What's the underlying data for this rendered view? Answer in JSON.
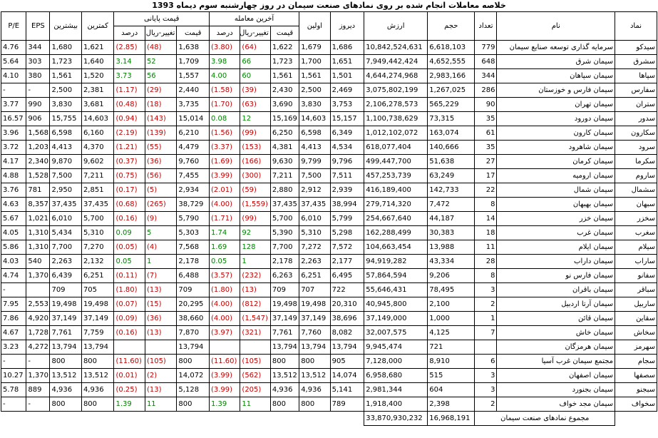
{
  "title": "خلاصه معاملات انجام شده بر روی نمادهای صنعت سیمان در روز چهارشنبه سوم دیماه 1393",
  "headers": {
    "symbol": "نماد",
    "name": "نام",
    "count": "تعداد",
    "volume": "حجم",
    "value": "ارزش",
    "yesterday": "دیروز",
    "first": "اولین",
    "last_trade": "آخرین معامله",
    "final_price": "قیمت پایانی",
    "price": "قیمت",
    "change": "تغییر-ریال",
    "percent": "درصد",
    "min": "کمترین",
    "max": "بیشترین",
    "eps": "EPS",
    "pe": "P/E"
  },
  "rows": [
    {
      "sym": "سیدکو",
      "name": "سرمایه گذاری توسعه صنایع سیمان",
      "count": "779",
      "vol": "6,618,103",
      "val": "10,842,524,631",
      "yest": "1,686",
      "first": "1,679",
      "lp": "1,622",
      "lc": "(64)",
      "lpct": "(3.80)",
      "fp": "1,638",
      "fc": "(48)",
      "fpct": "(2.85)",
      "min": "1,621",
      "max": "1,680",
      "eps": "344",
      "pe": "4.76"
    },
    {
      "sym": "سشرق",
      "name": "سیمان شرق",
      "count": "648",
      "vol": "4,652,555",
      "val": "7,949,442,424",
      "yest": "1,651",
      "first": "1,700",
      "lp": "1,723",
      "lc": "66",
      "lpct": "3.98",
      "fp": "1,709",
      "fc": "52",
      "fpct": "3.14",
      "min": "1,640",
      "max": "1,723",
      "eps": "303",
      "pe": "5.64"
    },
    {
      "sym": "سپاها",
      "name": "سیمان سپاهان",
      "count": "344",
      "vol": "2,983,166",
      "val": "4,644,274,968",
      "yest": "1,501",
      "first": "1,561",
      "lp": "1,561",
      "lc": "60",
      "lpct": "4.00",
      "fp": "1,557",
      "fc": "56",
      "fpct": "3.73",
      "min": "1,520",
      "max": "1,561",
      "eps": "380",
      "pe": "4.10"
    },
    {
      "sym": "سفارس",
      "name": "سیمان فارس و خوزستان",
      "count": "286",
      "vol": "1,267,025",
      "val": "3,075,802,199",
      "yest": "2,469",
      "first": "2,500",
      "lp": "2,430",
      "lc": "(39)",
      "lpct": "(1.58)",
      "fp": "2,440",
      "fc": "(29)",
      "fpct": "(1.17)",
      "min": "2,381",
      "max": "2,500",
      "eps": "-",
      "pe": "-"
    },
    {
      "sym": "ستران",
      "name": "سیمان تهران",
      "count": "90",
      "vol": "565,229",
      "val": "2,106,278,573",
      "yest": "3,753",
      "first": "3,830",
      "lp": "3,690",
      "lc": "(63)",
      "lpct": "(1.70)",
      "fp": "3,735",
      "fc": "(18)",
      "fpct": "(0.48)",
      "min": "3,681",
      "max": "3,830",
      "eps": "990",
      "pe": "3.77"
    },
    {
      "sym": "سدور",
      "name": "سیمان دورود",
      "count": "35",
      "vol": "73,315",
      "val": "1,100,738,629",
      "yest": "15,157",
      "first": "14,603",
      "lp": "15,169",
      "lc": "12",
      "lpct": "0.08",
      "fp": "15,014",
      "fc": "(143)",
      "fpct": "(0.94)",
      "min": "14,603",
      "max": "15,755",
      "eps": "906",
      "pe": "16.57"
    },
    {
      "sym": "سکارون",
      "name": "سیمان کارون",
      "count": "61",
      "vol": "163,074",
      "val": "1,012,102,072",
      "yest": "6,349",
      "first": "6,598",
      "lp": "6,250",
      "lc": "(99)",
      "lpct": "(1.56)",
      "fp": "6,210",
      "fc": "(139)",
      "fpct": "(2.19)",
      "min": "6,160",
      "max": "6,598",
      "eps": "1,568",
      "pe": "3.96"
    },
    {
      "sym": "سرود",
      "name": "سیمان شاهرود",
      "count": "35",
      "vol": "140,666",
      "val": "618,077,404",
      "yest": "4,534",
      "first": "4,413",
      "lp": "4,381",
      "lc": "(153)",
      "lpct": "(3.37)",
      "fp": "4,479",
      "fc": "(55)",
      "fpct": "(1.21)",
      "min": "4,370",
      "max": "4,413",
      "eps": "1,203",
      "pe": "3.72"
    },
    {
      "sym": "سکرما",
      "name": "سیمان کرمان",
      "count": "27",
      "vol": "51,638",
      "val": "499,447,700",
      "yest": "9,796",
      "first": "9,799",
      "lp": "9,630",
      "lc": "(166)",
      "lpct": "(1.69)",
      "fp": "9,760",
      "fc": "(36)",
      "fpct": "(0.37)",
      "min": "9,602",
      "max": "9,870",
      "eps": "2,340",
      "pe": "4.17"
    },
    {
      "sym": "ساروم",
      "name": "سیمان ارومیه",
      "count": "17",
      "vol": "63,249",
      "val": "457,253,739",
      "yest": "7,511",
      "first": "7,500",
      "lp": "7,211",
      "lc": "(300)",
      "lpct": "(3.99)",
      "fp": "7,455",
      "fc": "(56)",
      "fpct": "(0.75)",
      "min": "7,211",
      "max": "7,500",
      "eps": "1,528",
      "pe": "4.88"
    },
    {
      "sym": "سشمال",
      "name": "سیمان شمال",
      "count": "22",
      "vol": "142,733",
      "val": "416,189,400",
      "yest": "2,939",
      "first": "2,912",
      "lp": "2,880",
      "lc": "(59)",
      "lpct": "(2.01)",
      "fp": "2,934",
      "fc": "(5)",
      "fpct": "(0.17)",
      "min": "2,851",
      "max": "2,950",
      "eps": "781",
      "pe": "3.76"
    },
    {
      "sym": "سبهان",
      "name": "سیمان بهبهان",
      "count": "8",
      "vol": "7,472",
      "val": "279,714,320",
      "yest": "38,994",
      "first": "37,435",
      "lp": "37,435",
      "lc": "(1,559)",
      "lpct": "(4.00)",
      "fp": "38,729",
      "fc": "(265)",
      "fpct": "(0.68)",
      "min": "37,435",
      "max": "37,435",
      "eps": "8,357",
      "pe": "4.63"
    },
    {
      "sym": "سخزر",
      "name": "سیمان خزر",
      "count": "14",
      "vol": "44,187",
      "val": "254,667,640",
      "yest": "5,799",
      "first": "6,010",
      "lp": "5,700",
      "lc": "(99)",
      "lpct": "(1.71)",
      "fp": "5,790",
      "fc": "(9)",
      "fpct": "(0.16)",
      "min": "5,700",
      "max": "6,010",
      "eps": "1,021",
      "pe": "5.67"
    },
    {
      "sym": "سغرب",
      "name": "سیمان غرب",
      "count": "18",
      "vol": "30,383",
      "val": "162,288,499",
      "yest": "5,298",
      "first": "5,310",
      "lp": "5,390",
      "lc": "92",
      "lpct": "1.74",
      "fp": "5,303",
      "fc": "5",
      "fpct": "0.09",
      "min": "5,310",
      "max": "5,434",
      "eps": "1,310",
      "pe": "4.05"
    },
    {
      "sym": "سیلام",
      "name": "سیمان ایلام",
      "count": "11",
      "vol": "13,988",
      "val": "104,663,454",
      "yest": "7,572",
      "first": "7,272",
      "lp": "7,700",
      "lc": "128",
      "lpct": "1.69",
      "fp": "7,568",
      "fc": "(4)",
      "fpct": "(0.05)",
      "min": "7,270",
      "max": "7,700",
      "eps": "1,310",
      "pe": "5.86"
    },
    {
      "sym": "ساراب",
      "name": "سیمان داراب",
      "count": "28",
      "vol": "43,334",
      "val": "94,919,282",
      "yest": "2,177",
      "first": "2,263",
      "lp": "2,178",
      "lc": "1",
      "lpct": "0.05",
      "fp": "2,178",
      "fc": "1",
      "fpct": "0.05",
      "min": "2,132",
      "max": "2,263",
      "eps": "540",
      "pe": "4.03"
    },
    {
      "sym": "سفانو",
      "name": "سیمان فارس نو",
      "count": "8",
      "vol": "9,206",
      "val": "57,864,594",
      "yest": "6,495",
      "first": "6,251",
      "lp": "6,263",
      "lc": "(232)",
      "lpct": "(3.57)",
      "fp": "6,488",
      "fc": "(7)",
      "fpct": "(0.11)",
      "min": "6,251",
      "max": "6,439",
      "eps": "1,370",
      "pe": "4.74"
    },
    {
      "sym": "سباقر",
      "name": "سیمان باقران",
      "count": "3",
      "vol": "78,495",
      "val": "55,646,431",
      "yest": "722",
      "first": "707",
      "lp": "709",
      "lc": "(13)",
      "lpct": "(1.80)",
      "fp": "709",
      "fc": "(13)",
      "fpct": "(1.80)",
      "min": "705",
      "max": "709",
      "eps": "",
      "pe": "-"
    },
    {
      "sym": "ساربیل",
      "name": "سیمان آرتا اردبیل",
      "count": "2",
      "vol": "2,100",
      "val": "40,945,800",
      "yest": "20,310",
      "first": "19,498",
      "lp": "19,498",
      "lc": "(812)",
      "lpct": "(4.00)",
      "fp": "20,295",
      "fc": "(15)",
      "fpct": "(0.07)",
      "min": "19,498",
      "max": "19,498",
      "eps": "2,553",
      "pe": "7.95"
    },
    {
      "sym": "سقاین",
      "name": "سیمان قائن",
      "count": "1",
      "vol": "1,000",
      "val": "37,149,000",
      "yest": "38,696",
      "first": "37,149",
      "lp": "37,149",
      "lc": "(1,547)",
      "lpct": "(4.00)",
      "fp": "38,660",
      "fc": "(36)",
      "fpct": "(0.09)",
      "min": "37,149",
      "max": "37,149",
      "eps": "4,920",
      "pe": "7.86"
    },
    {
      "sym": "سخاش",
      "name": "سیمان خاش",
      "count": "7",
      "vol": "4,125",
      "val": "32,007,575",
      "yest": "8,082",
      "first": "7,760",
      "lp": "7,761",
      "lc": "(321)",
      "lpct": "(3.97)",
      "fp": "7,870",
      "fc": "(13)",
      "fpct": "(0.16)",
      "min": "7,759",
      "max": "7,761",
      "eps": "1,728",
      "pe": "4.67"
    },
    {
      "sym": "سهرمز",
      "name": "سیمان هرمزگان",
      "count": "",
      "vol": "721",
      "val": "9,945,474",
      "yest": "13,794",
      "first": "13,794",
      "lp": "13,794",
      "lc": "",
      "lpct": "",
      "fp": "13,794",
      "fc": "",
      "fpct": "",
      "min": "13,794",
      "max": "13,794",
      "eps": "4,272",
      "pe": "3.23"
    },
    {
      "sym": "سجام",
      "name": "مجتمع سیمان غرب آسیا",
      "count": "6",
      "vol": "8,910",
      "val": "7,128,000",
      "yest": "905",
      "first": "800",
      "lp": "800",
      "lc": "(105)",
      "lpct": "(11.60)",
      "fp": "800",
      "fc": "(105)",
      "fpct": "(11.60)",
      "min": "800",
      "max": "800",
      "eps": "-",
      "pe": "-"
    },
    {
      "sym": "سصفها",
      "name": "سیمان اصفهان",
      "count": "3",
      "vol": "515",
      "val": "6,958,680",
      "yest": "14,074",
      "first": "13,512",
      "lp": "13,512",
      "lc": "(562)",
      "lpct": "(3.99)",
      "fp": "14,072",
      "fc": "(2)",
      "fpct": "(0.01)",
      "min": "13,512",
      "max": "13,512",
      "eps": "1,370",
      "pe": "10.27"
    },
    {
      "sym": "سبجنو",
      "name": "سیمان بجنورد",
      "count": "3",
      "vol": "604",
      "val": "2,981,344",
      "yest": "5,141",
      "first": "4,936",
      "lp": "4,936",
      "lc": "(205)",
      "lpct": "(3.99)",
      "fp": "5,128",
      "fc": "(13)",
      "fpct": "(0.25)",
      "min": "4,936",
      "max": "4,936",
      "eps": "889",
      "pe": "5.78"
    },
    {
      "sym": "سخواف",
      "name": "سیمان مجد خواف",
      "count": "2",
      "vol": "2,398",
      "val": "1,918,400",
      "yest": "789",
      "first": "800",
      "lp": "800",
      "lc": "11",
      "lpct": "1.39",
      "fp": "800",
      "fc": "11",
      "fpct": "1.39",
      "min": "800",
      "max": "800",
      "eps": "-",
      "pe": "-"
    }
  ],
  "footer": {
    "label": "مجموع نمادهای صنعت سیمان",
    "total_volume": "16,968,191",
    "total_value": "33,870,930,232"
  }
}
